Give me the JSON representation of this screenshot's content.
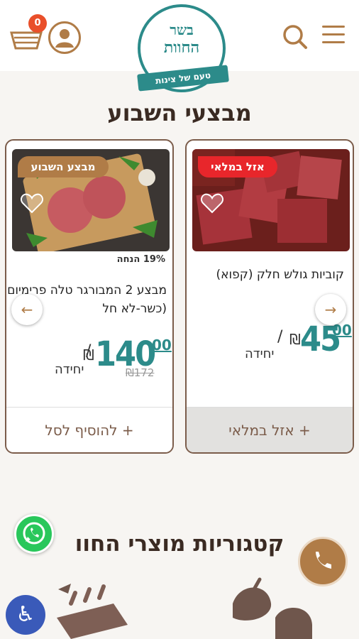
{
  "header": {
    "cart_count": "0",
    "logo_line1": "בשר",
    "logo_line2": "החוות",
    "logo_tagline": "טעם של צינות"
  },
  "deals": {
    "title": "מבצעי השבוע",
    "products": [
      {
        "badge": "אזל במלאי",
        "name": "קוביות גולש חלק (קפוא)",
        "price_main": "45",
        "price_cents": "00",
        "currency": "₪",
        "slash": "/",
        "unit": "יחידה",
        "button_label": "+ אזל במלאי"
      },
      {
        "badge": "מבצע השבוע",
        "discount": "19% הנחה",
        "name": "מבצע 2 המבורגר טלה פרימיום (כשר-לא חל",
        "price_main": "140",
        "price_cents": "00",
        "currency": "₪",
        "slash": "/",
        "unit": "יחידה",
        "old_price": "₪172",
        "button_label": "+ להוסיף לסל"
      }
    ]
  },
  "categories": {
    "title": "קטגוריות מוצרי החוו"
  },
  "colors": {
    "brand_brown": "#b07c47",
    "brand_teal": "#2c8b8a",
    "badge_red": "#e8262b",
    "whatsapp_green": "#29c75b",
    "accessibility_blue": "#3a5ab9"
  }
}
